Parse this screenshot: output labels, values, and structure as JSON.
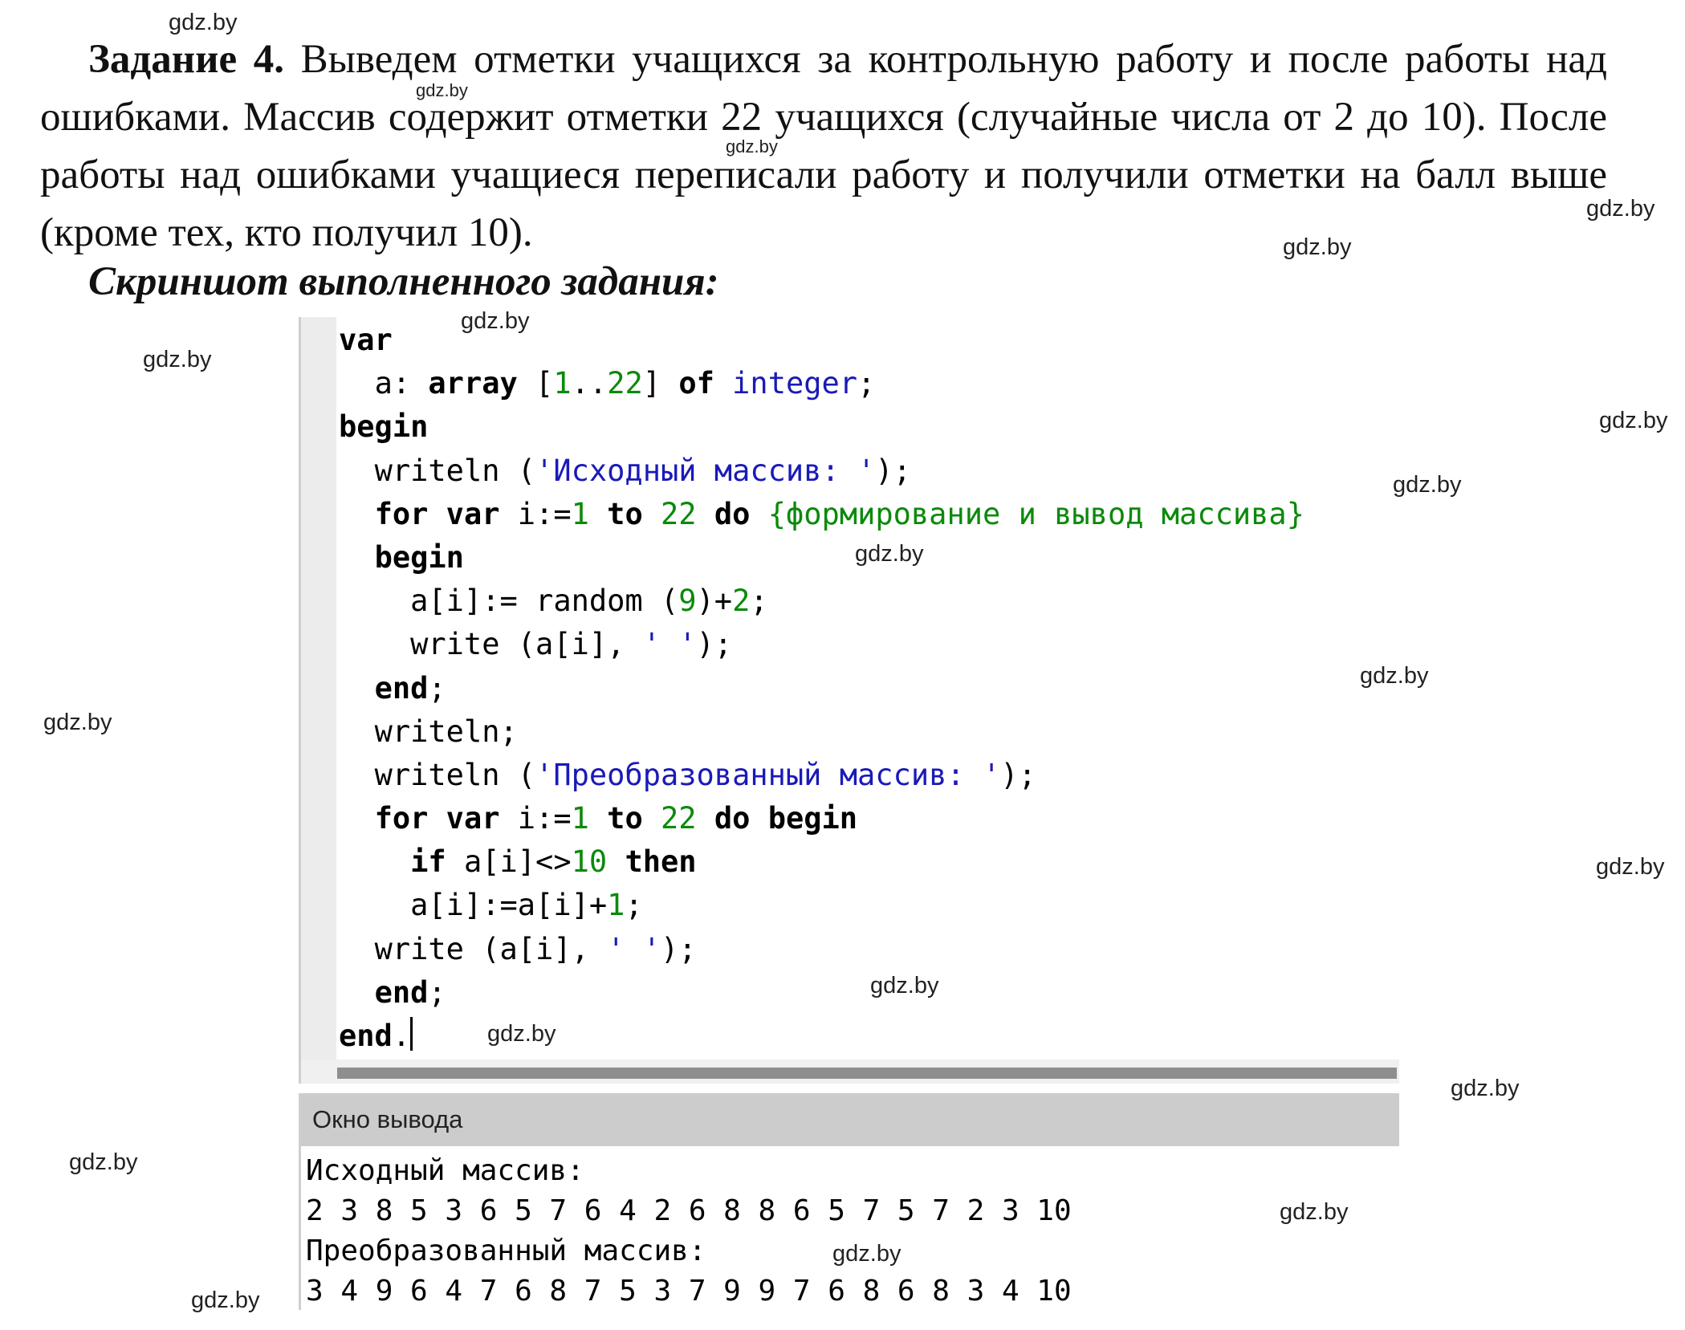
{
  "task": {
    "lead": "Задание 4.",
    "text": "Выведем отметки учащихся за контрольную работу и после работы над ошибками. Массив содержит отметки 22 учащихся (случайные числа от 2 до 10). После работы над ошибками учащиеся переписали работу и получили отметки на балл выше (кроме тех, кто получил 10)."
  },
  "subtitle": "Скриншот выполненного задания:",
  "watermark": "gdz.by",
  "code": {
    "l1": {
      "kw": "var"
    },
    "l2": {
      "id": "a: ",
      "kw": "array",
      "sp": " [",
      "n1": "1",
      "dots": "..",
      "n2": "22",
      "close": "] ",
      "kw2": "of",
      "sp2": " ",
      "type": "integer",
      "end": ";"
    },
    "l3": {
      "kw": "begin"
    },
    "l4": {
      "fn": "writeln (",
      "str": "'Исходный массив: '",
      "end": ");"
    },
    "l5": {
      "kw1": "for",
      "sp1": " ",
      "kw2": "var",
      "id": " i:=",
      "n1": "1",
      "sp2": " ",
      "kw3": "to",
      "sp3": " ",
      "n2": "22",
      "sp4": " ",
      "kw4": "do",
      "sp5": " ",
      "cmt": "{формирование и вывод массива}"
    },
    "l6": {
      "kw": "begin"
    },
    "l7": {
      "id": "a[i]:= random (",
      "n1": "9",
      "mid": ")+",
      "n2": "2",
      "end": ";"
    },
    "l8": {
      "id": "write (a[i], ",
      "str": "' '",
      "end": ");"
    },
    "l9": {
      "kw": "end",
      "end": ";"
    },
    "l10": {
      "id": "writeln;"
    },
    "l11": {
      "fn": "writeln (",
      "str": "'Преобразованный массив: '",
      "end": ");"
    },
    "l12": {
      "kw1": "for",
      "sp1": " ",
      "kw2": "var",
      "id": " i:=",
      "n1": "1",
      "sp2": " ",
      "kw3": "to",
      "sp3": " ",
      "n2": "22",
      "sp4": " ",
      "kw4": "do",
      "sp5": " ",
      "kw5": "begin"
    },
    "l13": {
      "kw1": "if",
      "id": " a[i]<>",
      "n1": "10",
      "sp": " ",
      "kw2": "then"
    },
    "l14": {
      "id": "a[i]:=a[i]+",
      "n1": "1",
      "end": ";"
    },
    "l15": {
      "id": "write (a[i], ",
      "str": "' '",
      "end": ");"
    },
    "l16": {
      "kw": "end",
      "end": ";"
    },
    "l17": {
      "kw": "end",
      "end": "."
    }
  },
  "output": {
    "title": "Окно вывода",
    "line1": "Исходный массив:",
    "line2": "2 3 8 5 3 6 5 7 6 4 2 6 8 8 6 5 7 5 7 2 3 10",
    "line3": "Преобразованный массив:",
    "line4": "3 4 9 6 4 7 6 8 7 5 3 7 9 9 7 6 8 6 8 3 4 10"
  },
  "colors": {
    "keyword": "#000000",
    "number": "#0b8a0b",
    "string": "#1a1ab8",
    "comment": "#0b8a0b",
    "output_header": "#cccccc"
  }
}
